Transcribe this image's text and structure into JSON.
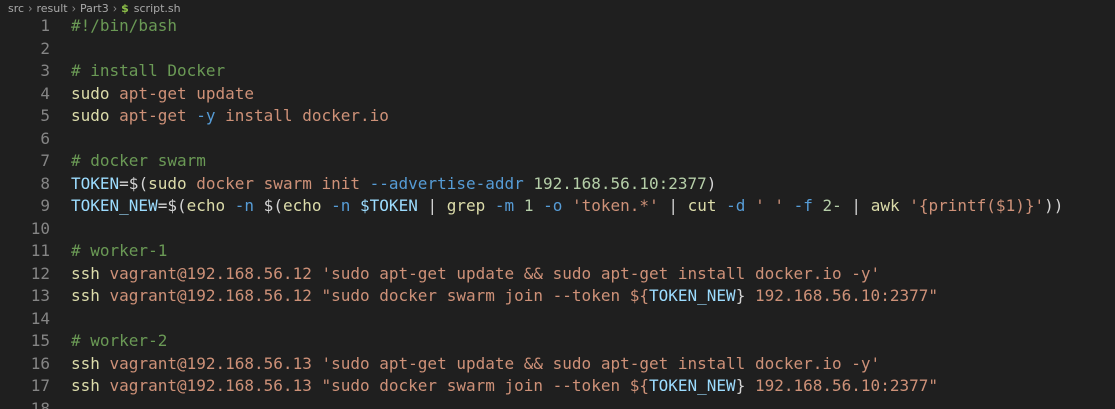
{
  "breadcrumb": {
    "items": [
      "src",
      "result",
      "Part3"
    ],
    "file_icon": "$",
    "file_name": "script.sh"
  },
  "lines": [
    {
      "n": "1",
      "tokens": [
        {
          "t": "#!/bin/bash",
          "c": "comment"
        }
      ]
    },
    {
      "n": "2",
      "tokens": []
    },
    {
      "n": "3",
      "tokens": [
        {
          "t": "# install Docker",
          "c": "comment"
        }
      ]
    },
    {
      "n": "4",
      "tokens": [
        {
          "t": "sudo",
          "c": "cmd"
        },
        {
          "t": " apt-get update",
          "c": "str"
        }
      ]
    },
    {
      "n": "5",
      "tokens": [
        {
          "t": "sudo",
          "c": "cmd"
        },
        {
          "t": " apt-get ",
          "c": "str"
        },
        {
          "t": "-y",
          "c": "flag"
        },
        {
          "t": " install docker.io",
          "c": "str"
        }
      ]
    },
    {
      "n": "6",
      "tokens": []
    },
    {
      "n": "7",
      "tokens": [
        {
          "t": "# docker swarm",
          "c": "comment"
        }
      ]
    },
    {
      "n": "8",
      "tokens": [
        {
          "t": "TOKEN",
          "c": "var"
        },
        {
          "t": "=$(",
          "c": "op"
        },
        {
          "t": "sudo",
          "c": "cmd"
        },
        {
          "t": " docker swarm init ",
          "c": "str"
        },
        {
          "t": "--advertise-addr",
          "c": "flag"
        },
        {
          "t": " ",
          "c": "plain"
        },
        {
          "t": "192.168.56.10:2377",
          "c": "num"
        },
        {
          "t": ")",
          "c": "op"
        }
      ]
    },
    {
      "n": "9",
      "tokens": [
        {
          "t": "TOKEN_NEW",
          "c": "var"
        },
        {
          "t": "=$(",
          "c": "op"
        },
        {
          "t": "echo",
          "c": "cmd"
        },
        {
          "t": " ",
          "c": "plain"
        },
        {
          "t": "-n",
          "c": "flag"
        },
        {
          "t": " $(",
          "c": "op"
        },
        {
          "t": "echo",
          "c": "cmd"
        },
        {
          "t": " ",
          "c": "plain"
        },
        {
          "t": "-n",
          "c": "flag"
        },
        {
          "t": " ",
          "c": "plain"
        },
        {
          "t": "$TOKEN",
          "c": "var"
        },
        {
          "t": " | ",
          "c": "op"
        },
        {
          "t": "grep",
          "c": "cmd"
        },
        {
          "t": " ",
          "c": "plain"
        },
        {
          "t": "-m",
          "c": "flag"
        },
        {
          "t": " ",
          "c": "plain"
        },
        {
          "t": "1",
          "c": "num"
        },
        {
          "t": " ",
          "c": "plain"
        },
        {
          "t": "-o",
          "c": "flag"
        },
        {
          "t": " ",
          "c": "plain"
        },
        {
          "t": "'token.*'",
          "c": "str"
        },
        {
          "t": " | ",
          "c": "op"
        },
        {
          "t": "cut",
          "c": "cmd"
        },
        {
          "t": " ",
          "c": "plain"
        },
        {
          "t": "-d",
          "c": "flag"
        },
        {
          "t": " ",
          "c": "plain"
        },
        {
          "t": "' '",
          "c": "str"
        },
        {
          "t": " ",
          "c": "plain"
        },
        {
          "t": "-f",
          "c": "flag"
        },
        {
          "t": " ",
          "c": "plain"
        },
        {
          "t": "2-",
          "c": "num"
        },
        {
          "t": " | ",
          "c": "op"
        },
        {
          "t": "awk",
          "c": "cmd"
        },
        {
          "t": " ",
          "c": "plain"
        },
        {
          "t": "'{printf($1)}'",
          "c": "str"
        },
        {
          "t": "))",
          "c": "op"
        }
      ]
    },
    {
      "n": "10",
      "tokens": []
    },
    {
      "n": "11",
      "tokens": [
        {
          "t": "# worker-1",
          "c": "comment"
        }
      ]
    },
    {
      "n": "12",
      "tokens": [
        {
          "t": "ssh",
          "c": "cmd"
        },
        {
          "t": " vagrant@192.168.56.12 ",
          "c": "str"
        },
        {
          "t": "'sudo apt-get update && sudo apt-get install docker.io -y'",
          "c": "str"
        }
      ]
    },
    {
      "n": "13",
      "tokens": [
        {
          "t": "ssh",
          "c": "cmd"
        },
        {
          "t": " vagrant@192.168.56.12 ",
          "c": "str"
        },
        {
          "t": "\"sudo docker swarm join --token ${",
          "c": "str"
        },
        {
          "t": "TOKEN_NEW",
          "c": "var"
        },
        {
          "t": "}",
          "c": "op"
        },
        {
          "t": " 192.168.56.10:2377\"",
          "c": "str"
        }
      ]
    },
    {
      "n": "14",
      "tokens": []
    },
    {
      "n": "15",
      "tokens": [
        {
          "t": "# worker-2",
          "c": "comment"
        }
      ]
    },
    {
      "n": "16",
      "tokens": [
        {
          "t": "ssh",
          "c": "cmd"
        },
        {
          "t": " vagrant@192.168.56.13 ",
          "c": "str"
        },
        {
          "t": "'sudo apt-get update && sudo apt-get install docker.io -y'",
          "c": "str"
        }
      ]
    },
    {
      "n": "17",
      "tokens": [
        {
          "t": "ssh",
          "c": "cmd"
        },
        {
          "t": " vagrant@192.168.56.13 ",
          "c": "str"
        },
        {
          "t": "\"sudo docker swarm join --token ${",
          "c": "str"
        },
        {
          "t": "TOKEN_NEW",
          "c": "var"
        },
        {
          "t": "}",
          "c": "op"
        },
        {
          "t": " 192.168.56.10:2377\"",
          "c": "str"
        }
      ]
    },
    {
      "n": "18",
      "tokens": []
    }
  ]
}
